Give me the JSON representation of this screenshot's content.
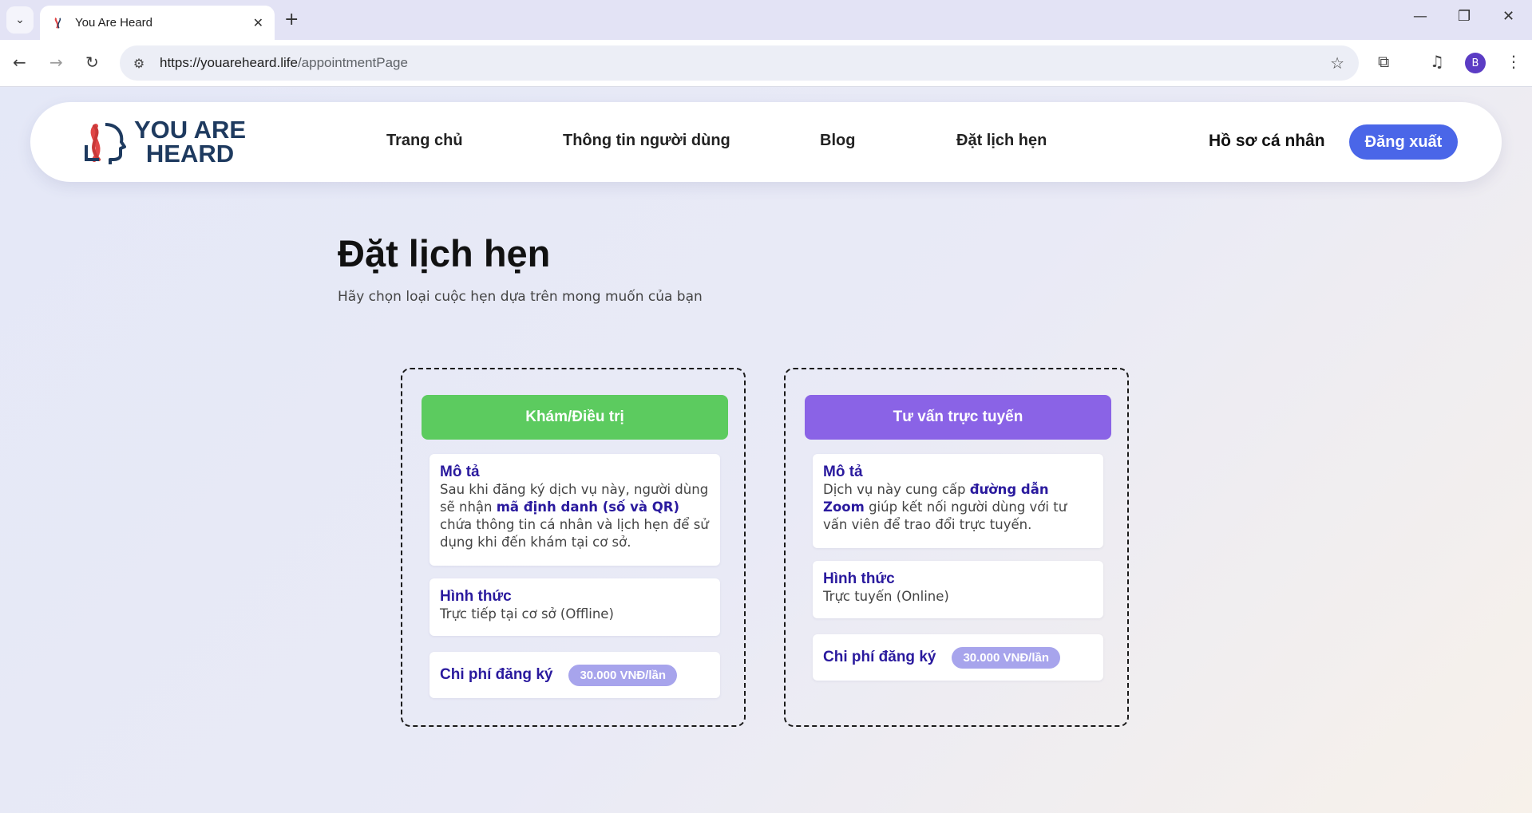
{
  "browser": {
    "tab_title": "You Are Heard",
    "url_host": "https://youareheard.life",
    "url_path": "/appointmentPage",
    "profile_initial": "B"
  },
  "header": {
    "logo_line1": "YOU ARE",
    "logo_line2": "HEARD",
    "nav": [
      "Trang chủ",
      "Thông tin người dùng",
      "Blog",
      "Đặt lịch hẹn"
    ],
    "profile_link": "Hồ sơ cá nhân",
    "logout_label": "Đăng xuất"
  },
  "page": {
    "title": "Đặt lịch hẹn",
    "subtitle": "Hãy chọn loại cuộc hẹn dựa trên mong muốn của bạn"
  },
  "cards": [
    {
      "heading": "Khám/Điều trị",
      "accent": "#5ccb5f",
      "desc_label": "Mô tả",
      "desc_pre": "Sau khi đăng ký dịch vụ này, người dùng sẽ nhận ",
      "desc_bold": "mã định danh (số và QR)",
      "desc_post": " chứa thông tin cá nhân và lịch hẹn để sử dụng khi đến khám tại cơ sở.",
      "form_label": "Hình thức",
      "form_value": "Trực tiếp tại cơ sở (Offline)",
      "fee_label": "Chi phí đăng ký",
      "fee_value": "30.000 VNĐ/lần"
    },
    {
      "heading": "Tư vấn trực tuyến",
      "accent": "#8a63e6",
      "desc_label": "Mô tả",
      "desc_pre": "Dịch vụ này cung cấp ",
      "desc_bold": "đường dẫn Zoom",
      "desc_post": " giúp kết nối người dùng với tư vấn viên để trao đổi trực tuyến.",
      "form_label": "Hình thức",
      "form_value": "Trực tuyến (Online)",
      "fee_label": "Chi phí đăng ký",
      "fee_value": "30.000 VNĐ/lần"
    }
  ],
  "colors": {
    "brand_blue": "#4a66e8",
    "label_purple": "#2a1a9e",
    "fee_badge": "#a7a4ec"
  }
}
